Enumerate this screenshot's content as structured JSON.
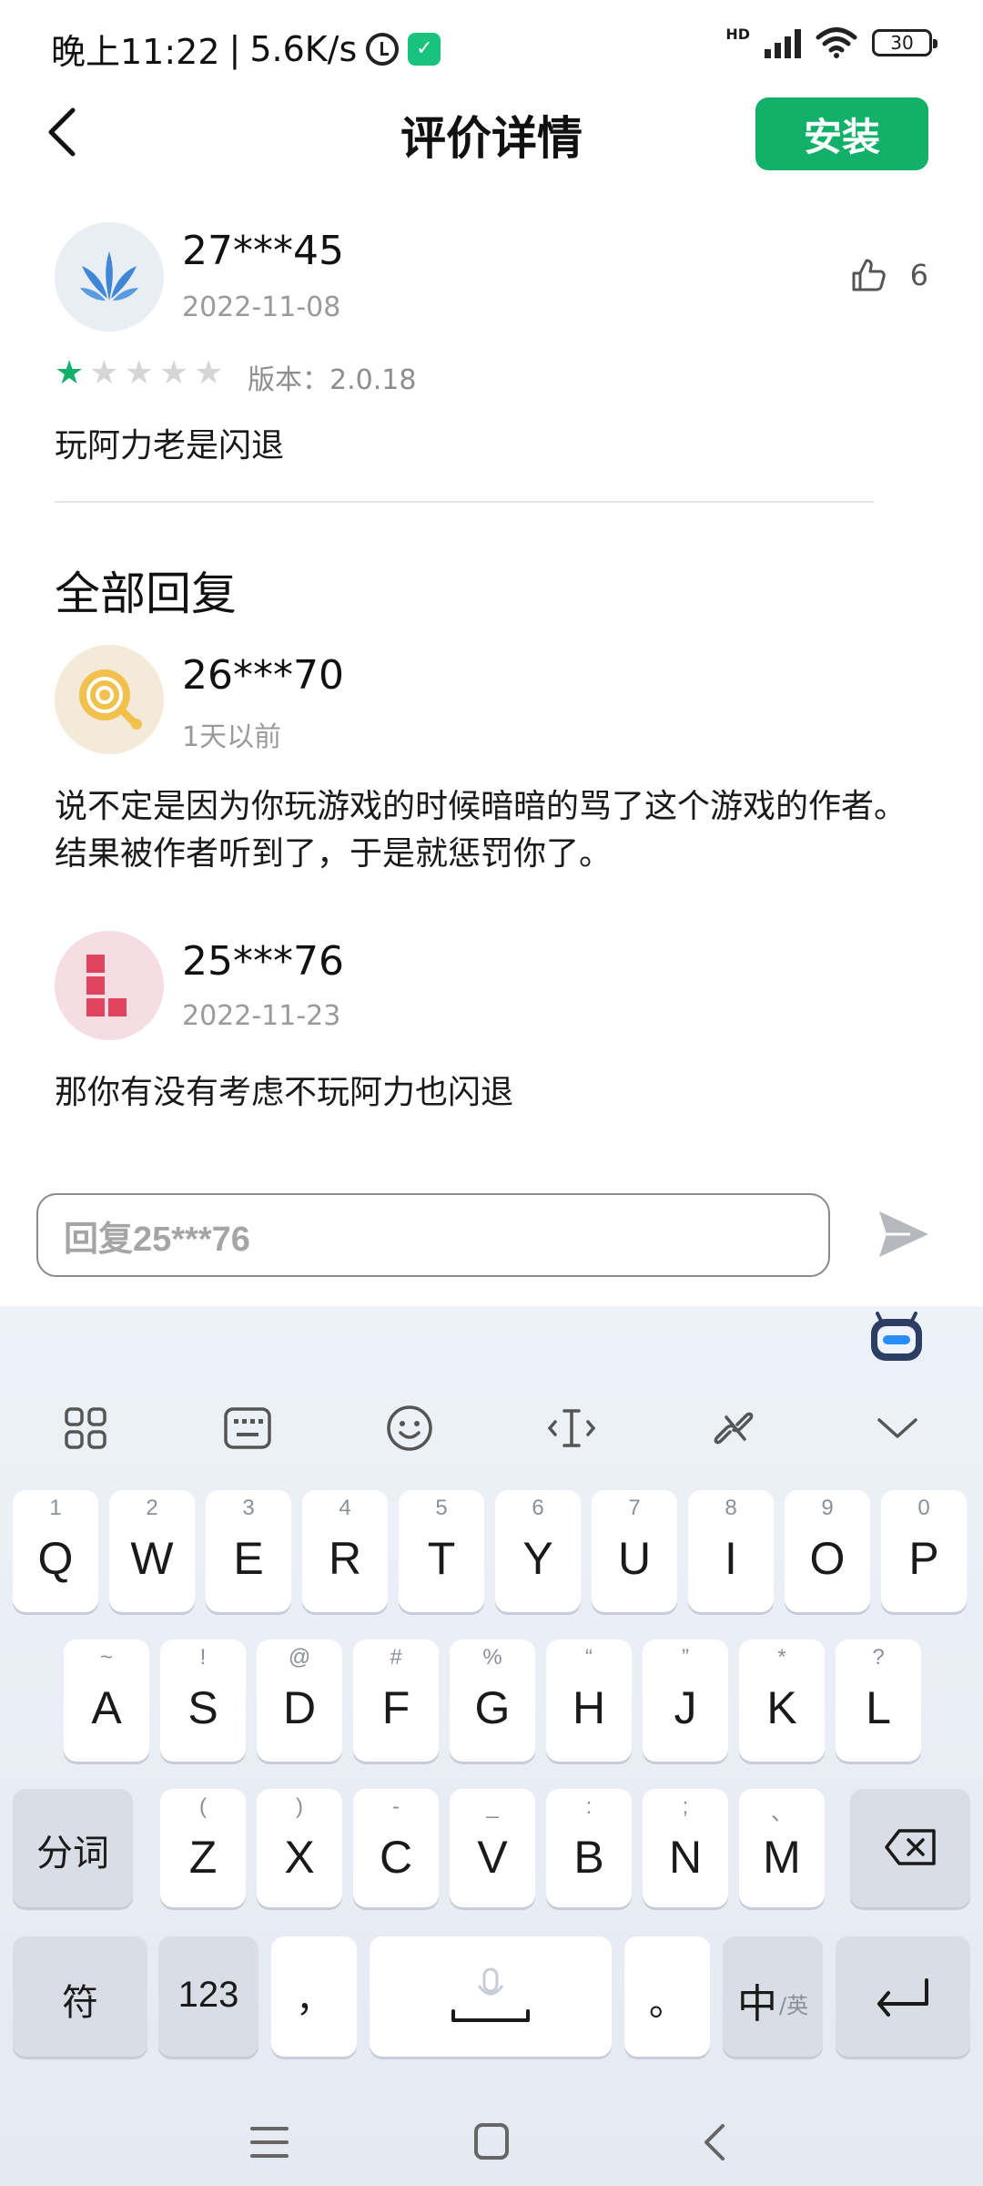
{
  "status": {
    "time": "晚上11:22",
    "separator": "|",
    "speed": "5.6K/s",
    "battery": "30",
    "network": "HD"
  },
  "header": {
    "title": "评价详情",
    "install_label": "安装"
  },
  "review": {
    "username": "27***45",
    "date": "2022-11-08",
    "likes": "6",
    "rating": 1,
    "rating_max": 5,
    "version": "版本：2.0.18",
    "text": "玩阿力老是闪退"
  },
  "replies_section": {
    "title": "全部回复",
    "items": [
      {
        "username": "26***70",
        "date": "1天以前",
        "text": "说不定是因为你玩游戏的时候暗暗的骂了这个游戏的作者。结果被作者听到了，于是就惩罚你了。"
      },
      {
        "username": "25***76",
        "date": "2022-11-23",
        "text": "那你有没有考虑不玩阿力也闪退"
      }
    ]
  },
  "reply_input": {
    "placeholder": "回复25***76"
  },
  "keyboard": {
    "row1": [
      {
        "main": "Q",
        "sub": "1"
      },
      {
        "main": "W",
        "sub": "2"
      },
      {
        "main": "E",
        "sub": "3"
      },
      {
        "main": "R",
        "sub": "4"
      },
      {
        "main": "T",
        "sub": "5"
      },
      {
        "main": "Y",
        "sub": "6"
      },
      {
        "main": "U",
        "sub": "7"
      },
      {
        "main": "I",
        "sub": "8"
      },
      {
        "main": "O",
        "sub": "9"
      },
      {
        "main": "P",
        "sub": "0"
      }
    ],
    "row2": [
      {
        "main": "A",
        "sub": "~"
      },
      {
        "main": "S",
        "sub": "!"
      },
      {
        "main": "D",
        "sub": "@"
      },
      {
        "main": "F",
        "sub": "#"
      },
      {
        "main": "G",
        "sub": "%"
      },
      {
        "main": "H",
        "sub": "“"
      },
      {
        "main": "J",
        "sub": "”"
      },
      {
        "main": "K",
        "sub": "*"
      },
      {
        "main": "L",
        "sub": "?"
      }
    ],
    "row3": [
      {
        "main": "Z",
        "sub": "("
      },
      {
        "main": "X",
        "sub": ")"
      },
      {
        "main": "C",
        "sub": "-"
      },
      {
        "main": "V",
        "sub": "_"
      },
      {
        "main": "B",
        "sub": ":"
      },
      {
        "main": "N",
        "sub": ";"
      },
      {
        "main": "M",
        "sub": "、"
      }
    ],
    "segment_label": "分词",
    "symbol_label": "符",
    "number_label": "123",
    "comma_label": "，",
    "period_label": "。",
    "lang_main": "中",
    "lang_sub": "/英"
  },
  "colors": {
    "accent": "#13b06a",
    "star_on": "#13b06a",
    "star_off": "#d6d6d6",
    "muted_text": "#9a9a9a"
  }
}
